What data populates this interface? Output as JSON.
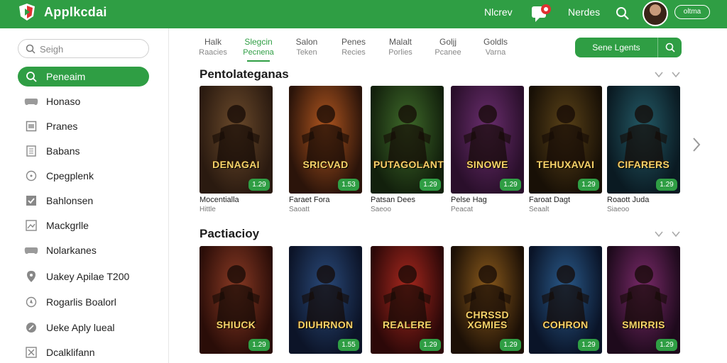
{
  "app": {
    "title": "Applkcdai",
    "logo_icon": "play-shield-logo"
  },
  "topbar": {
    "links": [
      "Nlcrev",
      "Nerdes"
    ],
    "chat_icon": "chat-bubble-icon",
    "search_icon": "search-icon",
    "pill_label": "oltma",
    "accent": "#2f9e44"
  },
  "sidebar": {
    "search_placeholder": "Seigh",
    "items": [
      {
        "label": "Peneaim",
        "icon": "search-icon",
        "active": true
      },
      {
        "label": "Honaso",
        "icon": "controller-icon"
      },
      {
        "label": "Pranes",
        "icon": "box-icon"
      },
      {
        "label": "Babans",
        "icon": "book-icon"
      },
      {
        "label": "Cpegplenk",
        "icon": "clock-icon"
      },
      {
        "label": "Bahlonsen",
        "icon": "check-square-icon"
      },
      {
        "label": "Mackgrlle",
        "icon": "image-icon"
      },
      {
        "label": "Nolarkanes",
        "icon": "controller-icon"
      },
      {
        "label": "Uakey Apilae T200",
        "icon": "pin-icon"
      },
      {
        "label": "Rogarlis Boalorl",
        "icon": "compass-icon"
      },
      {
        "label": "Ueke Aply lueal",
        "icon": "shield-icon"
      },
      {
        "label": "Dcalklifann",
        "icon": "close-box-icon"
      }
    ]
  },
  "tabs": [
    {
      "label": "Halk",
      "sub": "Raacies"
    },
    {
      "label": "Slegcin",
      "sub": "Pecnena",
      "active": true
    },
    {
      "label": "Salon",
      "sub": "Teken"
    },
    {
      "label": "Penes",
      "sub": "Recies"
    },
    {
      "label": "Malalt",
      "sub": "Porlies"
    },
    {
      "label": "Goljj",
      "sub": "Pcanee"
    },
    {
      "label": "Goldls",
      "sub": "Varna"
    }
  ],
  "cta": {
    "label": "Sene Lgents",
    "icon": "search-icon"
  },
  "sections": [
    {
      "title": "Pentolateganas",
      "cards": [
        {
          "art_title": "DENAGAI",
          "rating": "1.29",
          "name": "Mocentialla",
          "meta": "Hittle",
          "colors": [
            "#6b4a2b",
            "#2a1a10"
          ]
        },
        {
          "art_title": "SRICVAD",
          "rating": "1.53",
          "name": "Faraet Fora",
          "meta": "Saoatt",
          "colors": [
            "#b0561f",
            "#2b140a"
          ]
        },
        {
          "art_title": "PUTAGOLANT",
          "rating": "1.29",
          "name": "Patsan Dees",
          "meta": "Saeoo",
          "colors": [
            "#3f6a2a",
            "#12200c"
          ]
        },
        {
          "art_title": "SINOWE",
          "rating": "1.29",
          "name": "Pelse Hag",
          "meta": "Peacat",
          "colors": [
            "#6a2e6e",
            "#2a0f2b"
          ]
        },
        {
          "art_title": "TEHUXAVAI",
          "rating": "1.29",
          "name": "Faroat Dagt",
          "meta": "Seaalt",
          "colors": [
            "#5a4218",
            "#181006"
          ]
        },
        {
          "art_title": "CIFARERS",
          "rating": "1.29",
          "name": "Roaott Juda",
          "meta": "Siaeoo",
          "colors": [
            "#245a66",
            "#0a1a22"
          ]
        }
      ]
    },
    {
      "title": "Pactiacioy",
      "cards": [
        {
          "art_title": "SHIUCK",
          "rating": "1.29",
          "name": "",
          "meta": "",
          "colors": [
            "#8a3a24",
            "#2a0d08"
          ]
        },
        {
          "art_title": "DIUHRNON",
          "rating": "1.55",
          "name": "",
          "meta": "",
          "colors": [
            "#2a4a7a",
            "#0c1428"
          ]
        },
        {
          "art_title": "REALERE",
          "rating": "1.29",
          "name": "",
          "meta": "",
          "colors": [
            "#a8281e",
            "#2c0808"
          ]
        },
        {
          "art_title": "CHRSSD XGMIES",
          "rating": "1.29",
          "name": "",
          "meta": "",
          "colors": [
            "#8a5a1c",
            "#1c1006"
          ]
        },
        {
          "art_title": "COHRON",
          "rating": "1.29",
          "name": "",
          "meta": "",
          "colors": [
            "#2a5a8a",
            "#0a1428"
          ]
        },
        {
          "art_title": "SMIRRIS",
          "rating": "1.29",
          "name": "",
          "meta": "",
          "colors": [
            "#7a2a6a",
            "#1e0a1c"
          ]
        }
      ]
    }
  ]
}
